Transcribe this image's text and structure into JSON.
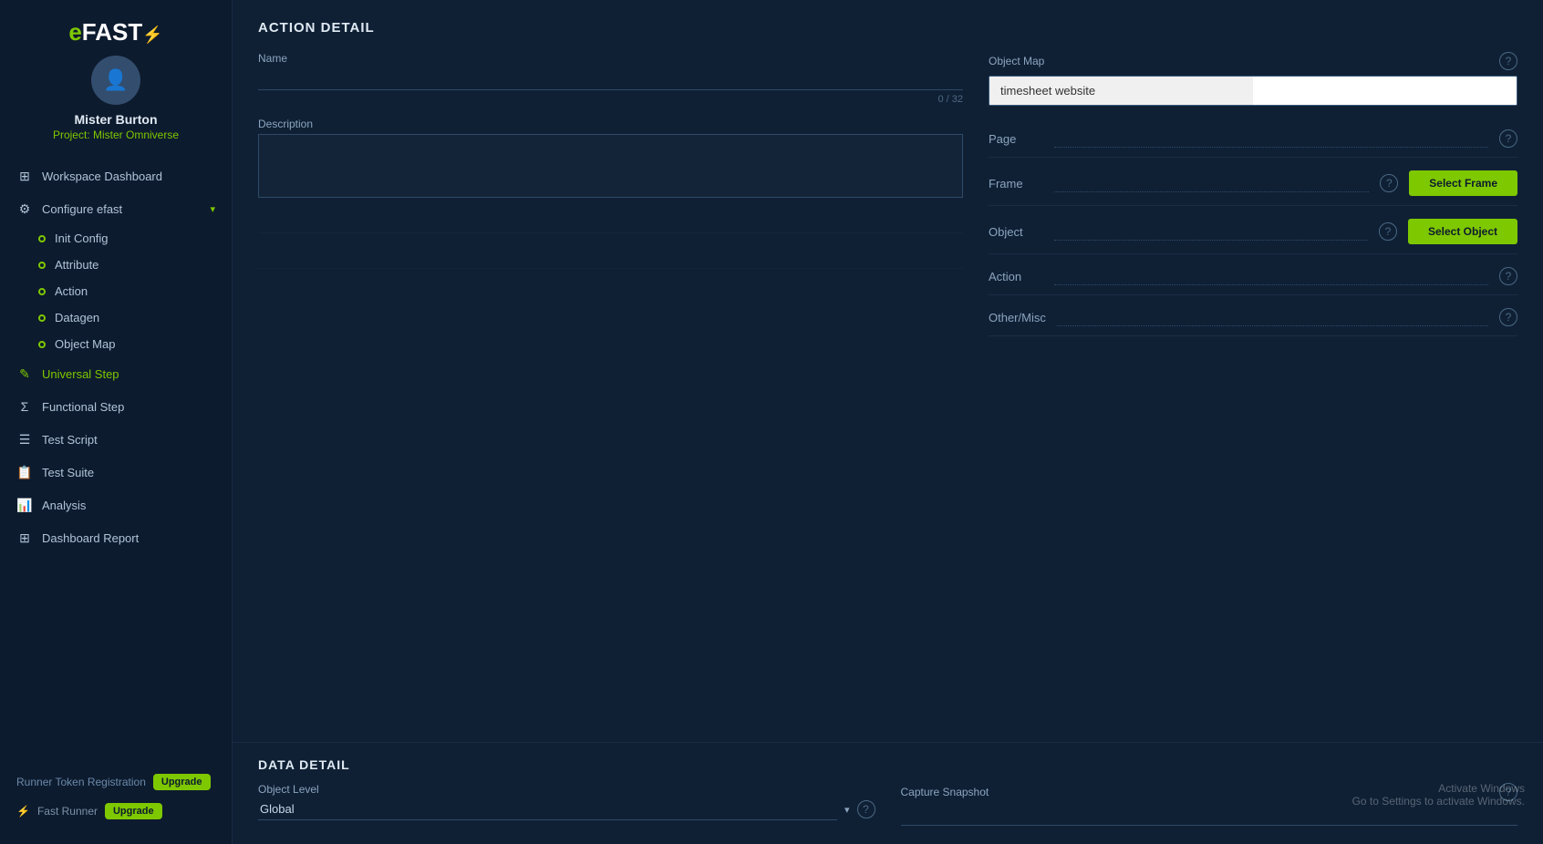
{
  "app": {
    "logo_prefix": "e",
    "logo_suffix": "FAST",
    "logo_symbol": "⚡"
  },
  "user": {
    "name": "Mister Burton",
    "project_label": "Project:",
    "project_name": "Mister Omniverse"
  },
  "sidebar": {
    "nav_items": [
      {
        "id": "workspace-dashboard",
        "label": "Workspace Dashboard",
        "icon": "⊞",
        "active": false,
        "expandable": false
      },
      {
        "id": "configure-efast",
        "label": "Configure efast",
        "icon": "⚙",
        "active": false,
        "expandable": true
      }
    ],
    "sub_items": [
      {
        "id": "init-config",
        "label": "Init Config"
      },
      {
        "id": "attribute",
        "label": "Attribute"
      },
      {
        "id": "action",
        "label": "Action"
      },
      {
        "id": "datagen",
        "label": "Datagen"
      },
      {
        "id": "object-map",
        "label": "Object Map"
      }
    ],
    "bottom_items": [
      {
        "id": "universal-step",
        "label": "Universal Step",
        "icon": "✎",
        "active": true
      },
      {
        "id": "functional-step",
        "label": "Functional Step",
        "icon": "Σ"
      },
      {
        "id": "test-script",
        "label": "Test Script",
        "icon": "☰"
      },
      {
        "id": "test-suite",
        "label": "Test Suite",
        "icon": "📋"
      },
      {
        "id": "analysis",
        "label": "Analysis",
        "icon": "📊"
      },
      {
        "id": "dashboard-report",
        "label": "Dashboard Report",
        "icon": "⊞"
      }
    ],
    "footer": [
      {
        "id": "runner-token",
        "label": "Runner Token Registration",
        "badge": "Upgrade"
      },
      {
        "id": "fast-runner",
        "label": "Fast Runner",
        "badge": "Upgrade"
      }
    ]
  },
  "action_detail": {
    "section_title": "ACTION DETAIL",
    "name_label": "Name",
    "name_value": "",
    "char_count": "0 / 32",
    "description_label": "Description",
    "description_value": "",
    "object_map_label": "Object Map",
    "object_map_value": "timesheet website",
    "object_map_extra": "",
    "help_icon": "?",
    "page_label": "Page",
    "page_value": "",
    "frame_label": "Frame",
    "frame_value": "",
    "select_frame_label": "Select Frame",
    "object_label": "Object",
    "object_value": "",
    "select_object_label": "Select Object",
    "action_label": "Action",
    "action_value": "",
    "other_misc_label": "Other/Misc",
    "other_misc_value": ""
  },
  "data_detail": {
    "section_title": "DATA DETAIL",
    "object_level_label": "Object Level",
    "object_level_value": "Global",
    "capture_snapshot_label": "Capture Snapshot",
    "capture_snapshot_value": ""
  },
  "activate_windows": {
    "line1": "Activate Windows",
    "line2": "Go to Settings to activate Windows."
  }
}
